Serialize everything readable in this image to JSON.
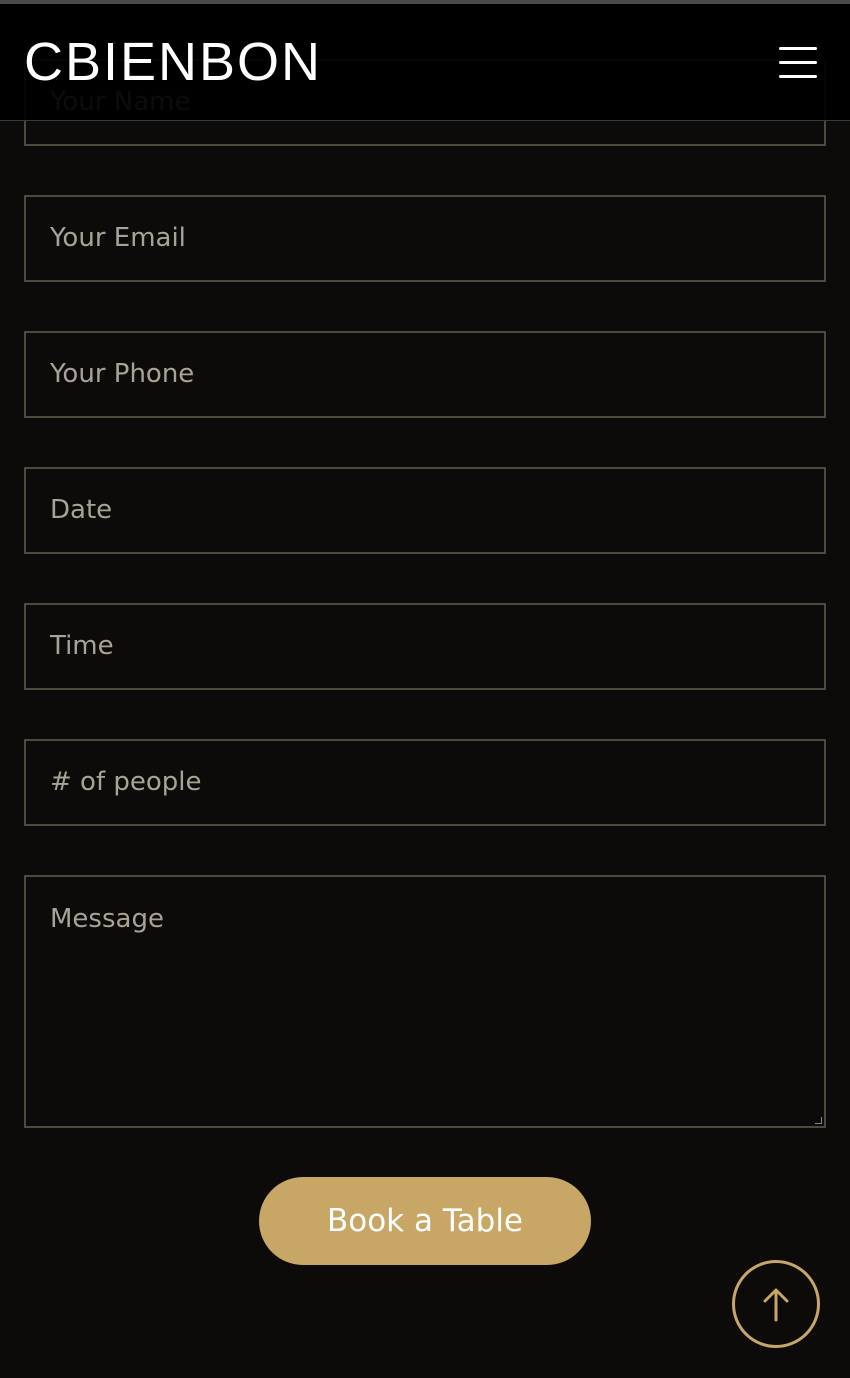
{
  "brand": {
    "logo_text": "CBIENBON"
  },
  "header": {
    "menu_icon": "hamburger-menu-icon"
  },
  "form": {
    "name_placeholder": "Your Name",
    "email_placeholder": "Your Email",
    "phone_placeholder": "Your Phone",
    "date_placeholder": "Date",
    "time_placeholder": "Time",
    "people_placeholder": "# of people",
    "message_placeholder": "Message",
    "submit_label": "Book a Table"
  },
  "back_to_top": {
    "icon": "arrow-up-icon"
  },
  "colors": {
    "accent": "#c8a665",
    "background": "#0c0b09",
    "field_border": "#4d4a3e",
    "placeholder": "#a8a396"
  }
}
